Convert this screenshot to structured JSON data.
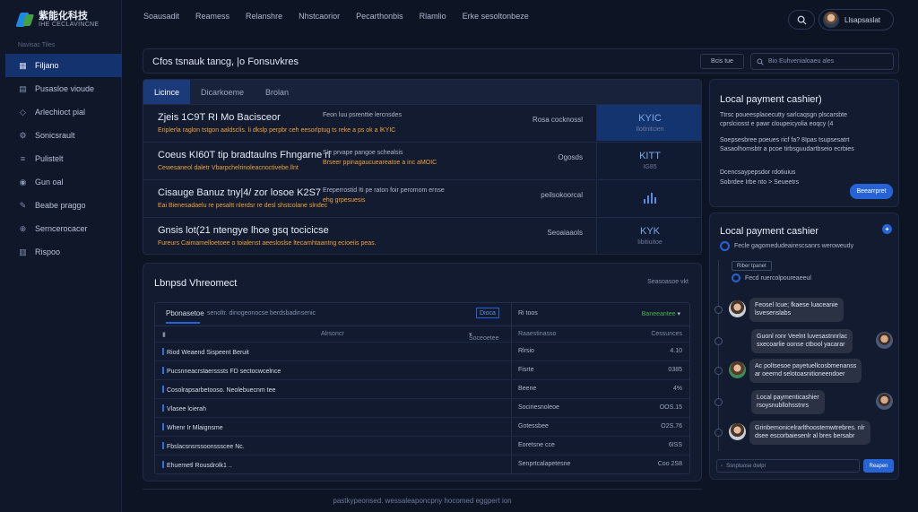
{
  "brand": {
    "title": "紫能化科技",
    "subtitle": "IHE CECLAVINCNE"
  },
  "sidebar": {
    "label": "Navisac Tiles",
    "items": [
      {
        "label": "Filjano",
        "icon": "grid-icon",
        "active": true
      },
      {
        "label": "Pusasloe vioude",
        "icon": "document-icon"
      },
      {
        "label": "Arlechioct pial",
        "icon": "tag-icon"
      },
      {
        "label": "Sonicsrault",
        "icon": "gear-icon"
      },
      {
        "label": "Pulistelt",
        "icon": "list-icon"
      },
      {
        "label": "Gun oal",
        "icon": "user-icon"
      },
      {
        "label": "Beabe praggo",
        "icon": "edit-icon"
      },
      {
        "label": "Serncerocacer",
        "icon": "link-icon"
      },
      {
        "label": "Rispoo",
        "icon": "chart-icon"
      }
    ]
  },
  "topnav": [
    "Soausadit",
    "Reamess",
    "Relanshre",
    "Nhstcaorior",
    "Pecarthonbis",
    "Rlamlio",
    "Erke sesoltonbeze"
  ],
  "user": {
    "name": "Llsapsaslat"
  },
  "banner": {
    "title": "Cfos tsnauk tancg, |o Fonsuvkres",
    "button": "Bcis tue",
    "search": "Bio Euhvenialoaeu ales"
  },
  "licenses": {
    "tabs": [
      "Licince",
      "Dicarkoeme",
      "Brolan"
    ],
    "rows": [
      {
        "name": "Zjeis 1C9T RI Mo Bacisceor",
        "sub": "Eriplerla raglon tstgon aaldsclis. li dkslp perpbr ceh eesorlptug ts reke a ps ok a lKYIC",
        "desc1": "Feon luu psrenttie lercnsdes",
        "desc2": "",
        "status": "Rosa cocknossl",
        "badge1": "KYIC",
        "badge2": "Ilotinitcien",
        "highlight": true
      },
      {
        "name": "Coeus KI60T tip bradtaulns Fhngarne rl",
        "sub": "Cewesaneol daletr Vbarpchelrinoleacnoctivebe.llnt",
        "desc1": "Sie prvape pangoe schealsis",
        "desc2": "Brseer ppinagaucueareatoe a inc aMOIC",
        "status": "Ogosds",
        "badge1": "KITT",
        "badge2": "IG85"
      },
      {
        "name": "Cisauge Banuz tny|4/ zor losoe K2S7",
        "sub": "Eai Bienesadaelu re pesaltt nlerdsr re desl shstcolane slndec",
        "desc1": "Ereperrostid Iti pe raton foir peromom ernse",
        "desc2": "ehg grpesuesis",
        "status": "peilsokoorcal",
        "badge1": "bars",
        "badge2": ""
      },
      {
        "name": "Gnsis lot(21 ntengye lhoe gsq tocicicse",
        "sub": "Fureurs Caimamelloetoee o toialenst aeesloslse ltecamhtaantng ecioeiis peas.",
        "desc1": "",
        "desc2": "",
        "status": "Seoaiaaols",
        "badge1": "KYK",
        "badge2": "Iibitiuitoe"
      }
    ]
  },
  "payment1": {
    "title": "Local payment cashier)",
    "lines": [
      "Ttrsc poueesplaoecutty sarlcaqsgn plscarsbte",
      "cprslciosst e pawr cloupeicyolia eoqcy (4",
      "Soepsesbree poeues ricf fa? 8Ipas tsupsesatrt",
      "Sasaolhomsbtr a pcoe tirbsguudartbseio ecrbies",
      "Dcencsaypepsdor rdotiuius",
      "Sobrdee Irbe nto > Seueetrs"
    ],
    "button": "Beearrpret"
  },
  "chat": {
    "title": "Local payment cashier",
    "online": "Fecle gagomedudeairescsanrs weroweudy",
    "tag": "Riber tpanet",
    "system": "Fecd ruercolpoureaeeul",
    "messages": [
      {
        "text": "Feosel Icue; fkaese luaceanie\nlsvesenslabs",
        "side": "left",
        "avatar": "f"
      },
      {
        "text": "Guonl ronr Veelnt luvesastnnrlac\nsxecoarlie oonse ctbool yacarar",
        "side": "right",
        "avatar": "m"
      },
      {
        "text": "Ac poltsesoe payetuellcosbmenanss\nar oeernd selotoasnitioneendoer",
        "side": "left",
        "avatar": "g"
      },
      {
        "text": "Local paymenticashier\nrsoysnubllohsstnrs",
        "side": "right",
        "avatar": "m"
      },
      {
        "text": "Grinbemonicelrarlthoostemwtrebres. nlr\ndsee escorbaiesenlr al bres bersabr",
        "side": "left",
        "avatar": "f"
      }
    ],
    "input_placeholder": "Ssnptuose dwlpr",
    "send": "Reapen"
  },
  "list": {
    "title": "Lbnpsd Vhreomect",
    "meta": "Seasoasoe vkt",
    "tab": "Pbonasetoe",
    "subtitle": "senoltr. dinogeonocse berdsbadinsenic",
    "badge": "Dioca",
    "right_header": "Ri toos",
    "right_select": "Baneeantee",
    "col_headers": [
      "Alrsoncr",
      "Soceoetee",
      "Raaestinasso",
      "Cessunces"
    ],
    "rows": [
      {
        "name": "Riod Weaend Sispeent Beruit",
        "status": "Rlrsio",
        "value": "4.10"
      },
      {
        "name": "Pucsnneacrstaersssts FD sectocwcelnce",
        "status": "Fisrte",
        "value": "0385"
      },
      {
        "name": "Cosolrapsarbetooso. Neolebuecnm tee",
        "status": "Beene",
        "value": "4%"
      },
      {
        "name": "Vlasee lcierah",
        "status": "Sociriesnoleoe",
        "value": "OOS.15"
      },
      {
        "name": "Whenr Ir Mlaignsme",
        "status": "Gotessbee",
        "value": "O2S.76"
      },
      {
        "name": "Fbslacsnsrssoonssscee Nc.",
        "status": "Eoretsne cce",
        "value": "6ISS"
      },
      {
        "name": "Ehuemetl Rousdrolk1 ..",
        "status": "Senprtcalapetesne",
        "value": "Coo 2S8"
      }
    ]
  },
  "footer": "pastkypeonsed. wessaleaponcpny hocomed eggpert ion"
}
